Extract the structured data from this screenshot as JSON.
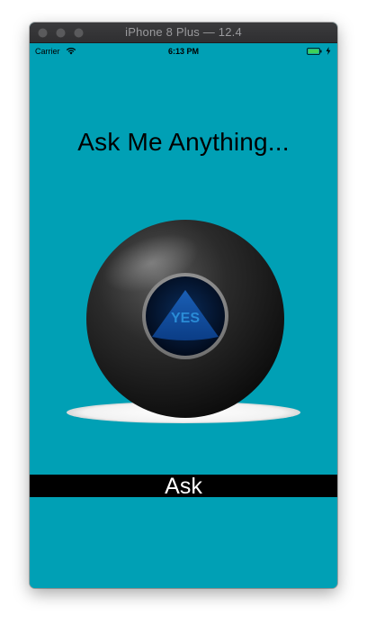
{
  "window": {
    "title": "iPhone 8 Plus — 12.4"
  },
  "status_bar": {
    "carrier": "Carrier",
    "time": "6:13 PM",
    "battery_level": 1.0
  },
  "main": {
    "headline": "Ask Me Anything...",
    "ball_answer": "YES",
    "ask_button_label": "Ask"
  },
  "colors": {
    "background": "#00a0b5",
    "ask_bar": "#000000",
    "ask_label": "#ffffff",
    "answer_text": "#2a8bd6"
  }
}
